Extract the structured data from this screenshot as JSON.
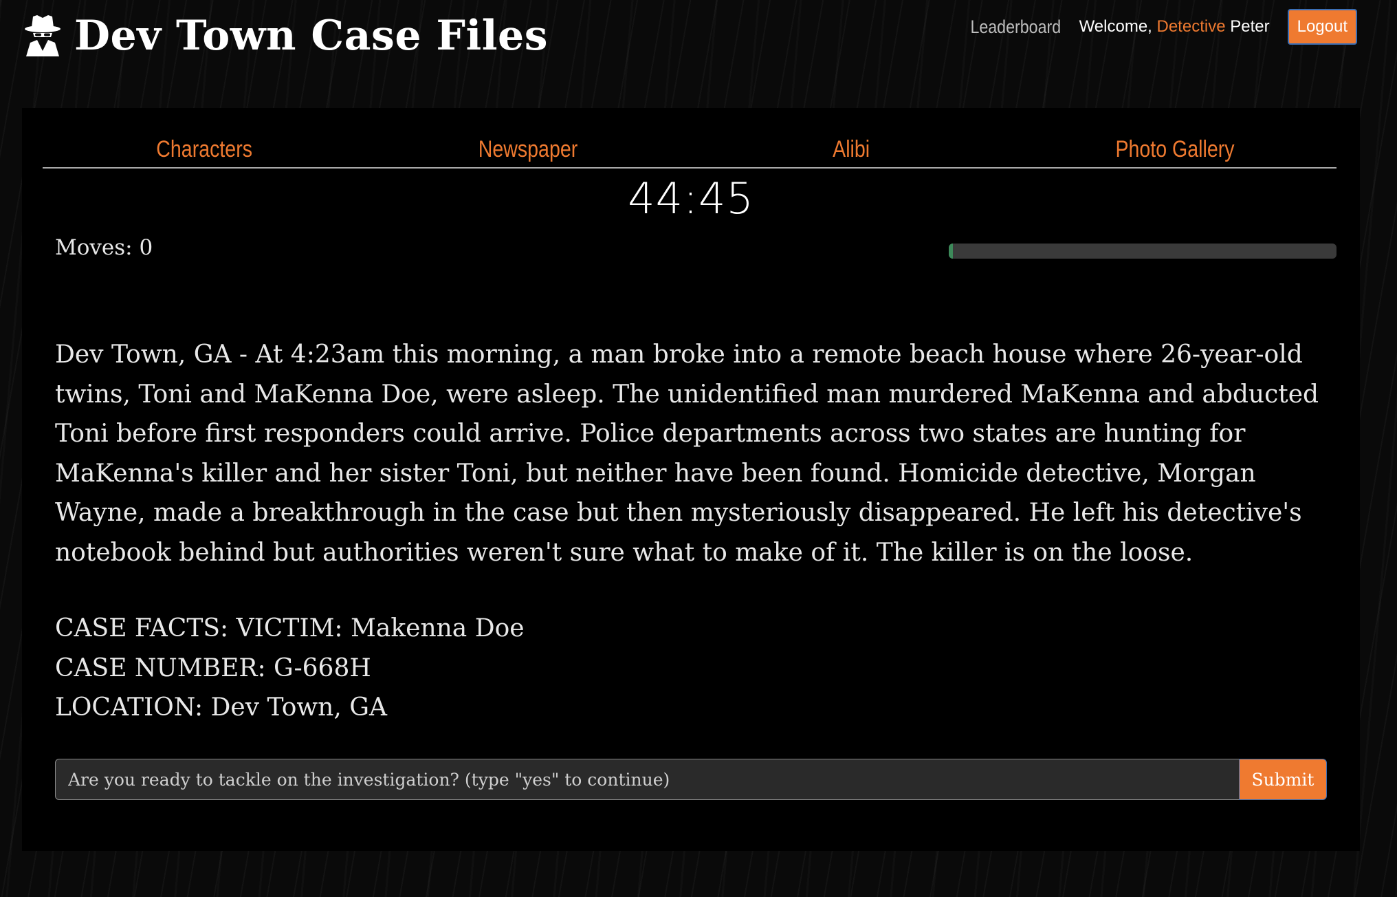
{
  "header": {
    "title": "Dev Town Case Files",
    "icon": "spy-detective-icon",
    "leaderboard_label": "Leaderboard",
    "welcome_prefix": "Welcome, ",
    "rank": "Detective",
    "username": "Peter",
    "logout_label": "Logout"
  },
  "tabs": [
    {
      "label": "Characters"
    },
    {
      "label": "Newspaper"
    },
    {
      "label": "Alibi"
    },
    {
      "label": "Photo Gallery"
    }
  ],
  "game": {
    "timer": "44:45",
    "moves_label": "Moves: 0",
    "progress_fraction": 0.01
  },
  "story": "Dev Town, GA - At 4:23am this morning, a man broke into a remote beach house where 26-year-old twins, Toni and MaKenna Doe, were asleep. The unidentified man murdered MaKenna and abducted Toni before first responders could arrive. Police departments across two states are hunting for MaKenna's killer and her sister Toni, but neither have been found. Homicide detective, Morgan Wayne, made a breakthrough in the case but then mysteriously disappeared. He left his detective's notebook behind but authorities weren't sure what to make of it. The killer is on the loose.",
  "facts": {
    "victim": "CASE FACTS: VICTIM: Makenna Doe",
    "case_number": "CASE NUMBER: G-668H",
    "location": "LOCATION: Dev Town, GA"
  },
  "form": {
    "placeholder": "Are you ready to tackle on the investigation? (type \"yes\" to continue)",
    "value": "",
    "submit_label": "Submit"
  },
  "colors": {
    "accent": "#ef7a30",
    "progress": "#3d8a5a",
    "background": "#000000"
  }
}
